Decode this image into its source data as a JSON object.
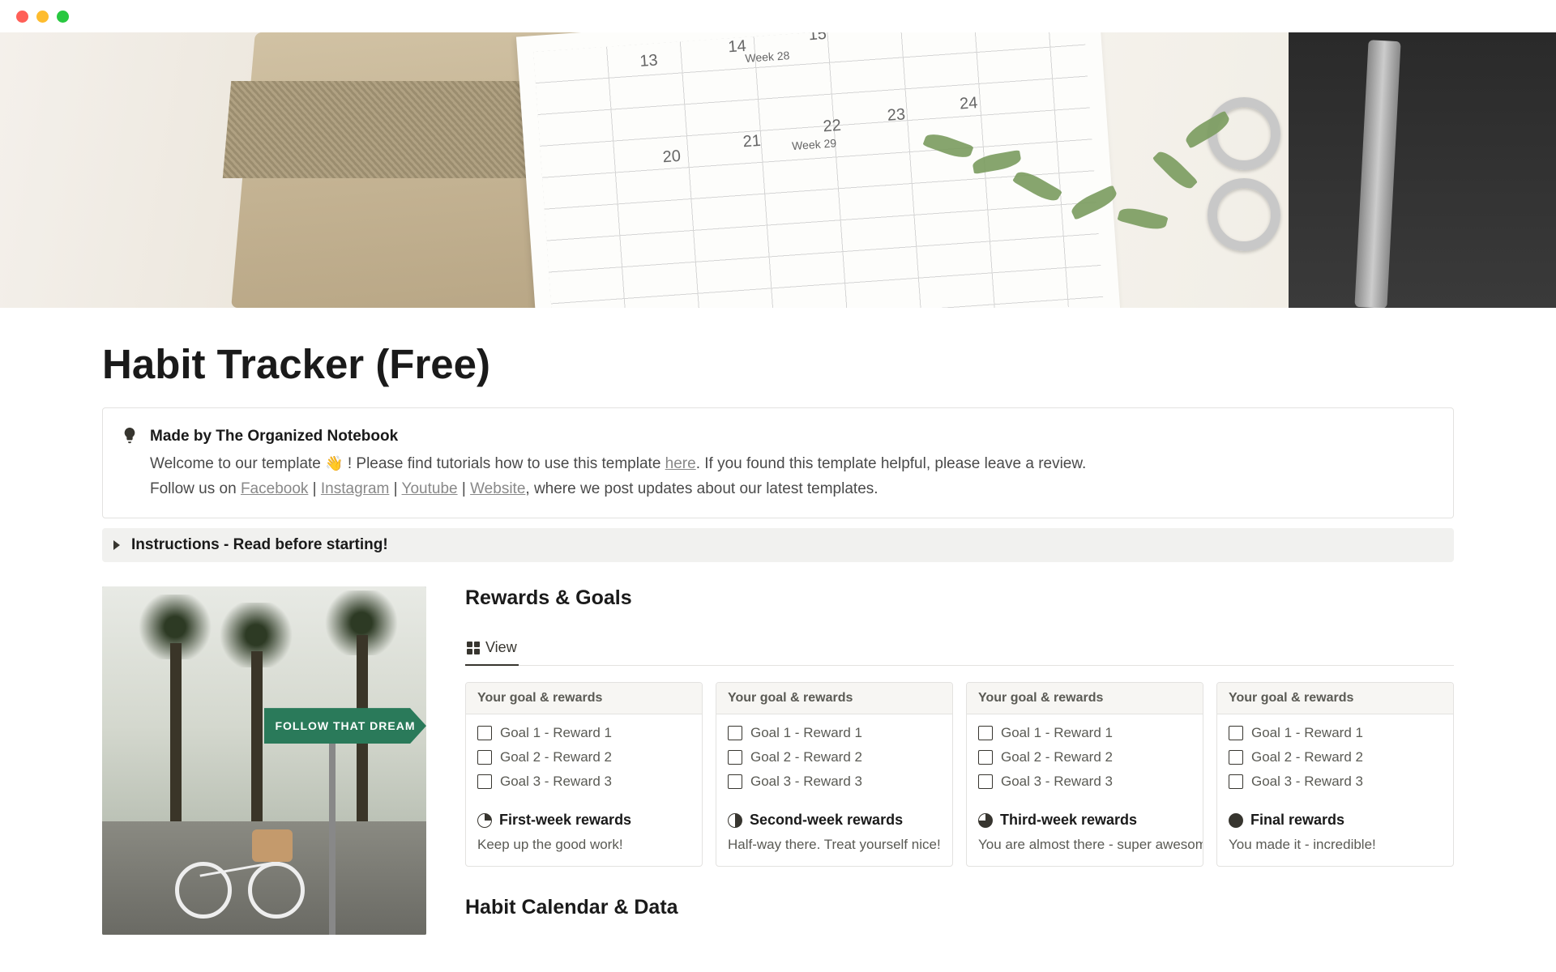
{
  "page": {
    "title": "Habit Tracker (Free)"
  },
  "callout": {
    "title": "Made by The Organized Notebook",
    "line1_a": "Welcome to our template ",
    "line1_b": " ! Please find tutorials how to use this template ",
    "link_here": "here",
    "line1_c": ". If you found this template helpful, please leave a review.",
    "line2_a": "Follow us on ",
    "link_fb": "Facebook",
    "sep": " | ",
    "link_ig": "Instagram",
    "link_yt": "Youtube",
    "link_web": "Website",
    "line2_b": ", where we post updates about our latest templates."
  },
  "toggle": {
    "label": "Instructions - Read before starting!"
  },
  "side_image": {
    "sign_text": "FOLLOW THAT DREAM"
  },
  "rewards": {
    "heading": "Rewards & Goals",
    "view_label": "View",
    "cards": [
      {
        "head": "Your goal & rewards",
        "items": [
          "Goal 1 - Reward 1",
          "Goal 2 - Reward 2",
          "Goal 3 - Reward 3"
        ],
        "title": "First-week rewards",
        "sub": "Keep up the good work!"
      },
      {
        "head": "Your goal & rewards",
        "items": [
          "Goal 1 - Reward 1",
          "Goal 2 - Reward 2",
          "Goal 3 - Reward 3"
        ],
        "title": "Second-week rewards",
        "sub": "Half-way there. Treat yourself nice!"
      },
      {
        "head": "Your goal & rewards",
        "items": [
          "Goal 1 - Reward 1",
          "Goal 2 - Reward 2",
          "Goal 3 - Reward 3"
        ],
        "title": "Third-week rewards",
        "sub": "You are almost there - super awesome"
      },
      {
        "head": "Your goal & rewards",
        "items": [
          "Goal 1 - Reward 1",
          "Goal 2 - Reward 2",
          "Goal 3 - Reward 3"
        ],
        "title": "Final rewards",
        "sub": "You made it - incredible!"
      }
    ]
  },
  "calendar": {
    "heading": "Habit Calendar & Data"
  }
}
